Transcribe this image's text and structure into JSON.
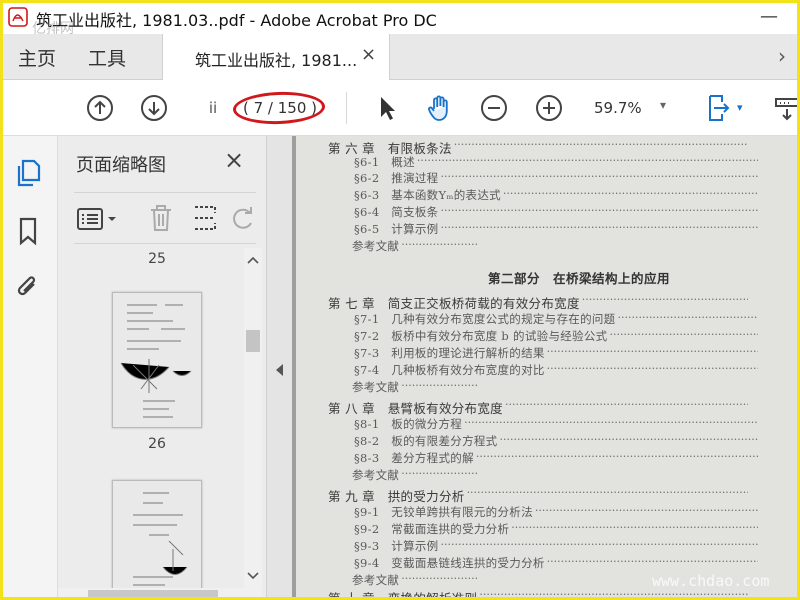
{
  "window": {
    "title": "筑工业出版社, 1981.03..pdf - Adobe Acrobat Pro DC",
    "minimize_glyph": "—",
    "watermark": "亿排网"
  },
  "tabs": {
    "home": "主页",
    "tools": "工具",
    "document": "筑工业出版社, 1981...",
    "close_glyph": "×",
    "next_glyph": "›"
  },
  "toolbar": {
    "page_input_value": "ii",
    "page_count": "( 7 / 150 )",
    "zoom": "59.7%",
    "zoom_caret": "▾",
    "view_caret": "▾"
  },
  "thumbnails": {
    "title": "页面缩略图",
    "close_glyph": "×",
    "labels": [
      "25",
      "26"
    ]
  },
  "document": {
    "part_title": "第二部分　在桥梁结构上的应用",
    "watermark": "www.chdao.com",
    "toc": [
      {
        "text": "第 六 章　有限板条法",
        "kind": "head"
      },
      {
        "text": "§6-1　概述",
        "kind": "sub"
      },
      {
        "text": "§6-2　推演过程",
        "kind": "sub"
      },
      {
        "text": "§6-3　基本函数Yₘ的表达式",
        "kind": "sub"
      },
      {
        "text": "§6-4　简支板条",
        "kind": "sub"
      },
      {
        "text": "§6-5　计算示例",
        "kind": "sub"
      },
      {
        "text": "参考文献",
        "kind": "ref"
      },
      {
        "text": "第 七 章　简支正交板桥荷载的有效分布宽度",
        "kind": "head"
      },
      {
        "text": "§7-1　几种有效分布宽度公式的规定与存在的问题",
        "kind": "sub"
      },
      {
        "text": "§7-2　板桥中有效分布宽度 b 的试验与经验公式",
        "kind": "sub"
      },
      {
        "text": "§7-3　利用板的理论进行解析的结果",
        "kind": "sub"
      },
      {
        "text": "§7-4　几种板桥有效分布宽度的对比",
        "kind": "sub"
      },
      {
        "text": "参考文献",
        "kind": "ref"
      },
      {
        "text": "第 八 章　悬臂板有效分布宽度",
        "kind": "head"
      },
      {
        "text": "§8-1　板的微分方程",
        "kind": "sub"
      },
      {
        "text": "§8-2　板的有限差分方程式",
        "kind": "sub"
      },
      {
        "text": "§8-3　差分方程式的解",
        "kind": "sub"
      },
      {
        "text": "参考文献",
        "kind": "ref"
      },
      {
        "text": "第 九 章　拱的受力分析",
        "kind": "head"
      },
      {
        "text": "§9-1　无铰单跨拱有限元的分析法",
        "kind": "sub"
      },
      {
        "text": "§9-2　常截面连拱的受力分析",
        "kind": "sub"
      },
      {
        "text": "§9-3　计算示例",
        "kind": "sub"
      },
      {
        "text": "§9-4　变截面悬链线连拱的受力分析",
        "kind": "sub"
      },
      {
        "text": "参考文献",
        "kind": "ref"
      },
      {
        "text": "第 十 章　变换的解析准则",
        "kind": "head"
      }
    ]
  },
  "colors": {
    "accent_blue": "#1a73c9",
    "annotation_red": "#d0171c",
    "frame_yellow": "#f3e21a"
  }
}
